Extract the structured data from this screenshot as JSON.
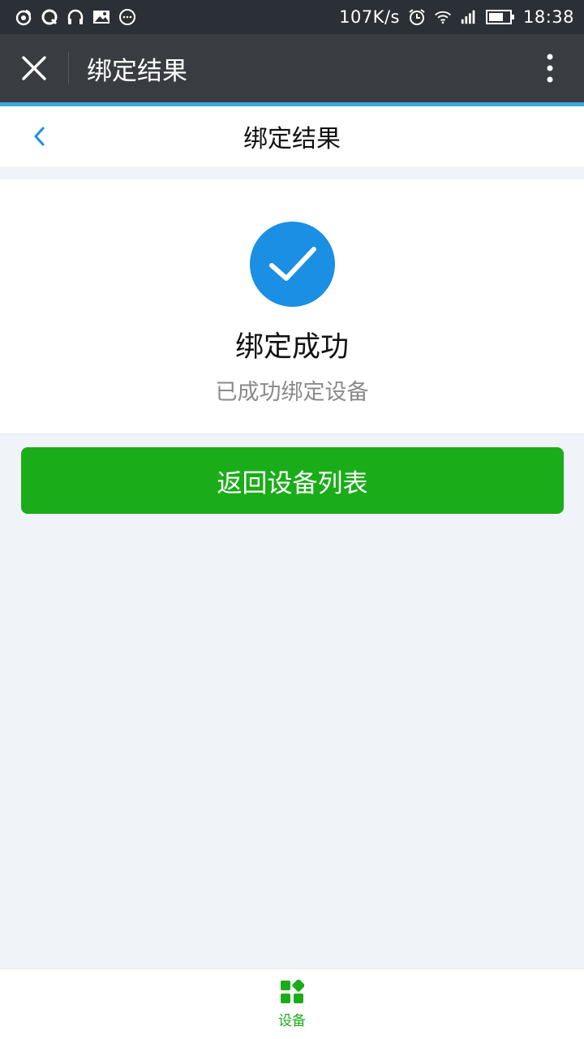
{
  "status_bar": {
    "network_speed": "107K/s",
    "time": "18:38",
    "icons_left": [
      "weibo-icon",
      "qq-icon",
      "headphones-icon",
      "image-icon",
      "message-icon"
    ],
    "icons_right": [
      "alarm-icon",
      "wifi-icon",
      "signal-icon",
      "battery-icon"
    ]
  },
  "title_bar": {
    "title": "绑定结果"
  },
  "page_header": {
    "title": "绑定结果"
  },
  "result": {
    "title": "绑定成功",
    "description": "已成功绑定设备"
  },
  "actions": {
    "primary_label": "返回设备列表"
  },
  "tab_bar": {
    "items": [
      {
        "label": "设备",
        "icon": "device-grid-icon",
        "active": true
      }
    ]
  },
  "colors": {
    "primary_green": "#1aad19",
    "success_blue": "#1a8fe3",
    "accent_blue": "#3ea7e0",
    "title_bar_bg": "#393d42"
  }
}
